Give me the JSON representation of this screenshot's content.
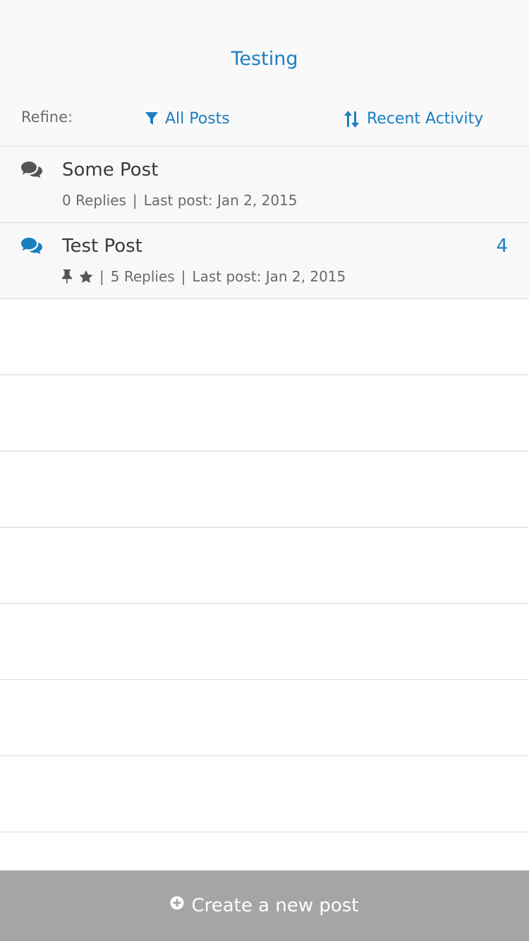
{
  "header": {
    "title": "Testing",
    "refine_label": "Refine:",
    "filter_label": "All Posts",
    "sort_label": "Recent Activity",
    "filter_icon": "filter-icon",
    "sort_icon": "sort-icon"
  },
  "posts": [
    {
      "title": "Some Post",
      "replies": "0 Replies",
      "last_post": "Last post: Jan 2, 2015",
      "icon": "comments-icon",
      "icon_color": "#555555",
      "unread": ""
    },
    {
      "title": "Test Post",
      "replies": "5 Replies",
      "last_post": "Last post: Jan 2, 2015",
      "icon": "comments-icon",
      "icon_color": "#1a7fc1",
      "unread": "4",
      "pinned_icon": "pin-icon",
      "starred_icon": "star-icon"
    }
  ],
  "footer": {
    "create_label": "Create a new post",
    "create_icon": "plus-circle-icon"
  },
  "colors": {
    "accent": "#1a7fc1",
    "footer_bg": "#a5a5a4",
    "header_bg": "#f9f9f9",
    "row_bg": "#f8f8f8"
  }
}
